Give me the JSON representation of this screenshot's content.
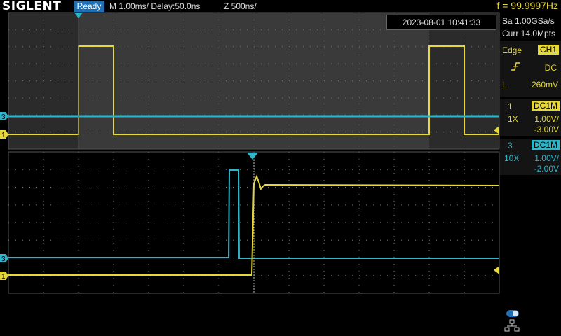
{
  "header": {
    "logo": "SIGLENT",
    "status": "Ready",
    "timebase": "M 1.00ms/ Delay:50.0ns",
    "zoom": "Z 500ns/",
    "frequency": "f = 99.9997Hz"
  },
  "datetime": "2023-08-01 10:41:33",
  "acquisition": {
    "sample_rate": "Sa 1.00GSa/s",
    "memory": "Curr 14.0Mpts"
  },
  "trigger": {
    "type": "Edge",
    "source": "CH1",
    "coupling": "DC",
    "level_label": "L",
    "level": "260mV"
  },
  "channels": [
    {
      "num": "1",
      "coupling": "DC1M",
      "probe": "1X",
      "scale": "1.00V/",
      "offset": "-3.00V",
      "color": "#e6d83a"
    },
    {
      "num": "3",
      "coupling": "DC1M",
      "probe": "10X",
      "scale": "1.00V/",
      "offset": "-2.00V",
      "color": "#2fb4c8"
    }
  ],
  "markers": {
    "ch1": "1",
    "ch3": "3"
  },
  "colors": {
    "ch1": "#e6d83a",
    "ch3": "#2fb4c8",
    "accent": "#1f6fb2"
  },
  "icons": [
    "trigger-rising-edge-icon",
    "usb-toggle-icon",
    "network-icon"
  ]
}
